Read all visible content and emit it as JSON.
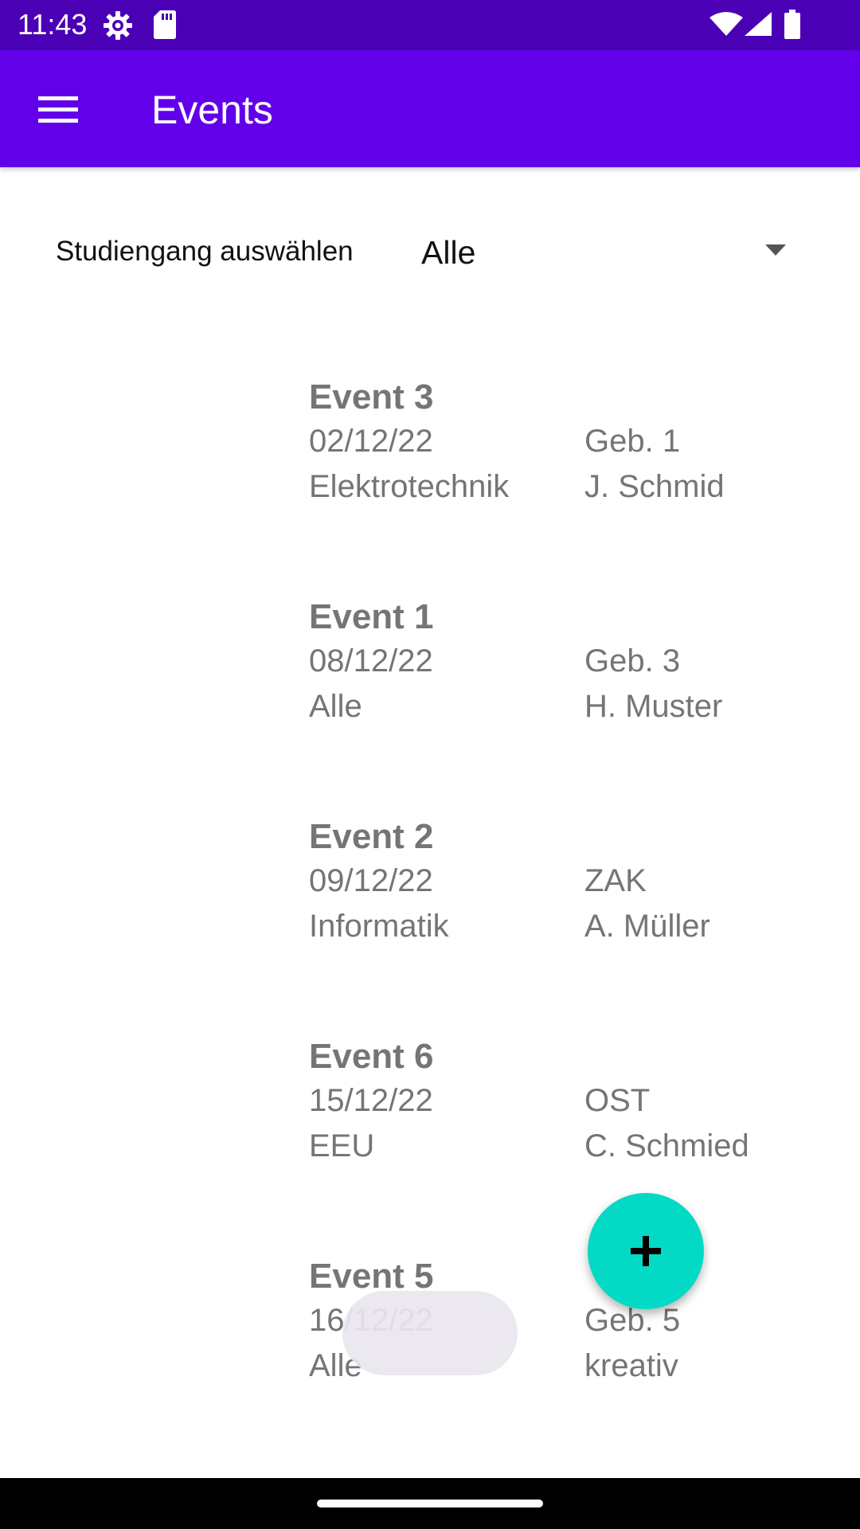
{
  "status_bar": {
    "time": "11:43",
    "left_icons": [
      "settings-gear-icon",
      "sd-card-icon"
    ],
    "right_icons": [
      "wifi-icon",
      "cell-signal-icon",
      "battery-icon"
    ]
  },
  "app_bar": {
    "title": "Events",
    "menu_icon": "hamburger-menu-icon",
    "color": "#6200ea"
  },
  "filter": {
    "label": "Studiengang auswählen",
    "selected": "Alle",
    "dropdown_icon": "dropdown-arrow-icon"
  },
  "events": [
    {
      "title": "Event 3",
      "date": "02/12/22",
      "location": "Geb. 1",
      "program": "Elektrotechnik",
      "organizer": "J. Schmid"
    },
    {
      "title": "Event 1",
      "date": "08/12/22",
      "location": "Geb. 3",
      "program": "Alle",
      "organizer": "H. Muster"
    },
    {
      "title": "Event 2",
      "date": "09/12/22",
      "location": "ZAK",
      "program": "Informatik",
      "organizer": "A. Müller"
    },
    {
      "title": "Event 6",
      "date": "15/12/22",
      "location": "OST",
      "program": "EEU",
      "organizer": "C. Schmied"
    },
    {
      "title": "Event 5",
      "date": "16/12/22",
      "location": "Geb. 5",
      "program": "Alle",
      "organizer": "kreativ"
    }
  ],
  "fab": {
    "icon": "plus-icon",
    "color": "#03dac5"
  }
}
